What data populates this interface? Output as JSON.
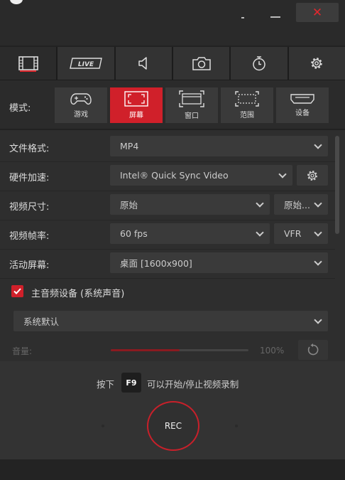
{
  "window": {
    "dots_label": "-",
    "close_label": "✕"
  },
  "tabs": [
    {
      "name": "video",
      "icon": "film-icon"
    },
    {
      "name": "live",
      "label": "LIVE",
      "icon": "live-icon"
    },
    {
      "name": "audio",
      "icon": "speaker-icon"
    },
    {
      "name": "screenshot",
      "icon": "camera-icon"
    },
    {
      "name": "timer",
      "icon": "stopwatch-icon"
    },
    {
      "name": "settings",
      "icon": "gear-icon"
    }
  ],
  "mode": {
    "label": "模式:",
    "options": [
      {
        "label": "游戏",
        "icon": "gamepad-icon"
      },
      {
        "label": "屏幕",
        "icon": "fullscreen-icon",
        "active": true
      },
      {
        "label": "窗口",
        "icon": "window-icon"
      },
      {
        "label": "范围",
        "icon": "region-icon"
      },
      {
        "label": "设备",
        "icon": "hdmi-icon"
      }
    ]
  },
  "settings": {
    "file_format": {
      "label": "文件格式:",
      "value": "MP4"
    },
    "hw_accel": {
      "label": "硬件加速:",
      "value": "Intel® Quick Sync Video"
    },
    "video_size": {
      "label": "视频尺寸:",
      "value": "原始",
      "value2": "原始..."
    },
    "frame_rate": {
      "label": "视频帧率:",
      "value": "60 fps",
      "value2": "VFR"
    },
    "active_screen": {
      "label": "活动屏幕:",
      "value": "桌面 [1600x900]"
    },
    "main_audio": {
      "label": "主音频设备 (系统声音)",
      "checked": true,
      "device": "系统默认"
    },
    "volume": {
      "label": "音量:",
      "value_text": "100%",
      "fraction": 0.5
    }
  },
  "record": {
    "hint_prefix": "按下",
    "hotkey": "F9",
    "hint_suffix": "可以开始/停止视频录制",
    "button_label": "REC"
  },
  "colors": {
    "accent": "#d0202a",
    "background": "#2e2e2e"
  }
}
